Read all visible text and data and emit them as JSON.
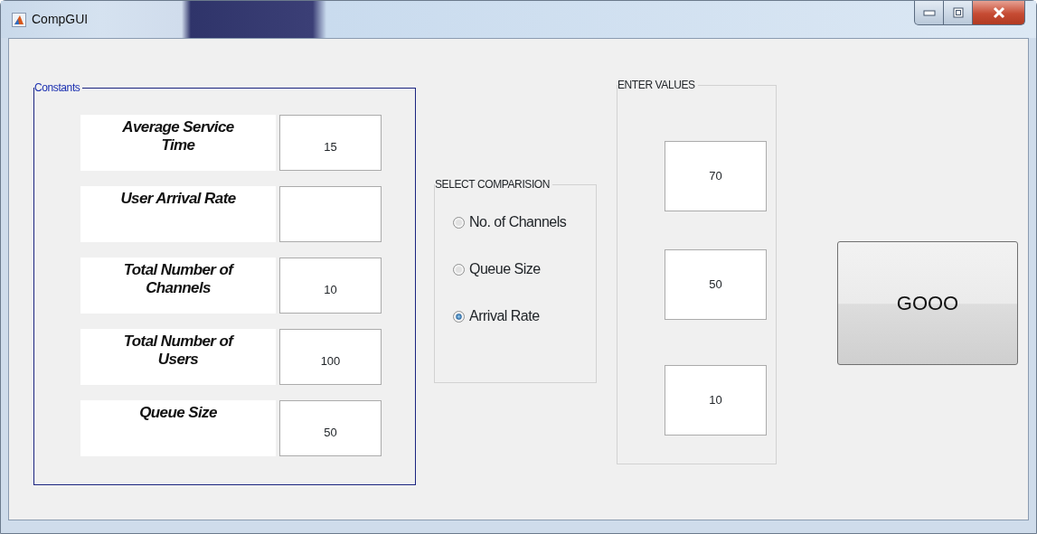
{
  "window": {
    "title": "CompGUI"
  },
  "constants": {
    "title": "Constants",
    "rows": [
      {
        "label": "Average Service Time",
        "value": "15"
      },
      {
        "label": "User Arrival Rate"
      },
      {
        "label": "Total Number of Channels",
        "value": "10"
      },
      {
        "label": "Total Number of Users",
        "value": "100"
      },
      {
        "label": "Queue Size",
        "value": "50"
      }
    ]
  },
  "comparison": {
    "title": "SELECT COMPARISION",
    "options": [
      {
        "label": "No. of Channels",
        "selected": false
      },
      {
        "label": "Queue Size",
        "selected": false
      },
      {
        "label": "Arrival Rate",
        "selected": true
      }
    ]
  },
  "enter_values": {
    "title": "ENTER VALUES",
    "values": [
      "70",
      "50",
      "10"
    ]
  },
  "button": {
    "label": "GOOO"
  }
}
